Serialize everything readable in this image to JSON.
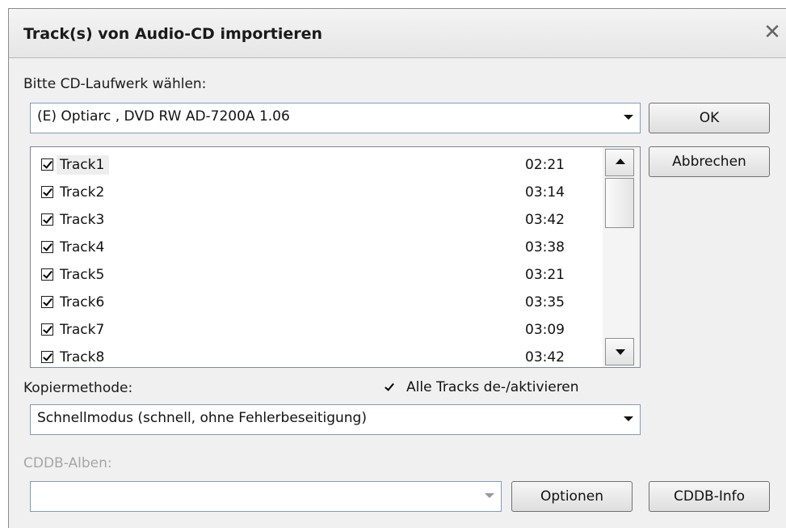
{
  "dialog": {
    "title": "Track(s) von Audio-CD importieren",
    "close_glyph": "✕"
  },
  "drive": {
    "label": "Bitte CD-Laufwerk wählen:",
    "selected": "(E) Optiarc , DVD RW AD-7200A   1.06"
  },
  "buttons": {
    "ok": "OK",
    "cancel": "Abbrechen",
    "options": "Optionen",
    "cddb_info": "CDDB-Info"
  },
  "tracks": [
    {
      "name": "Track1",
      "duration": "02:21",
      "checked": true
    },
    {
      "name": "Track2",
      "duration": "03:14",
      "checked": true
    },
    {
      "name": "Track3",
      "duration": "03:42",
      "checked": true
    },
    {
      "name": "Track4",
      "duration": "03:38",
      "checked": true
    },
    {
      "name": "Track5",
      "duration": "03:21",
      "checked": true
    },
    {
      "name": "Track6",
      "duration": "03:35",
      "checked": true
    },
    {
      "name": "Track7",
      "duration": "03:09",
      "checked": true
    },
    {
      "name": "Track8",
      "duration": "03:42",
      "checked": true
    }
  ],
  "copy_method": {
    "label": "Kopiermethode:",
    "selected": "Schnellmodus (schnell, ohne Fehlerbeseitigung)"
  },
  "toggle_all": {
    "label": "Alle Tracks de-/aktivieren",
    "checked": true
  },
  "cddb": {
    "label": "CDDB-Alben:",
    "selected": ""
  }
}
